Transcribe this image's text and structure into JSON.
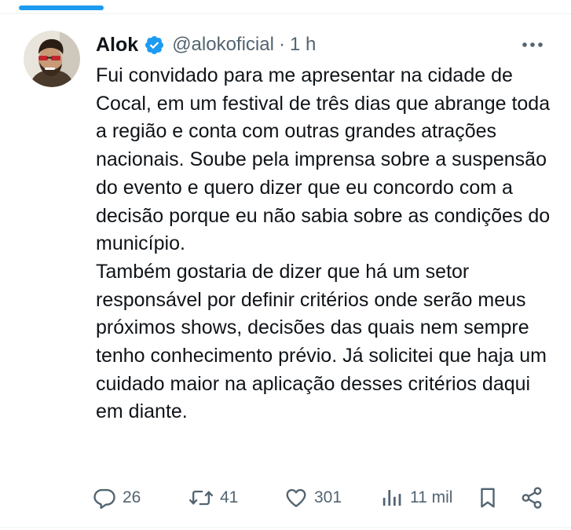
{
  "tweet": {
    "author": {
      "display_name": "Alok",
      "handle": "@alokoficial",
      "verified": true
    },
    "separator": "·",
    "time": "1 h",
    "paragraphs": [
      "Fui convidado para me apresentar na cidade de Cocal, em um festival de três dias que abrange toda a região e conta com outras grandes atrações nacionais. Soube pela imprensa sobre a suspensão do evento e quero dizer que eu concordo com a decisão porque eu não sabia sobre as condições do município.",
      "Também gostaria de dizer que há um setor responsável por definir critérios onde serão meus próximos shows, decisões das quais nem sempre tenho conhecimento prévio. Já solicitei que haja um cuidado maior na aplicação desses critérios daqui em diante."
    ],
    "metrics": {
      "replies": "26",
      "reposts": "41",
      "likes": "301",
      "views": "11 mil"
    },
    "icons": {
      "verified": "verified-badge-icon",
      "more": "more-icon",
      "reply": "reply-icon",
      "repost": "repost-icon",
      "like": "heart-icon",
      "views": "views-icon",
      "bookmark": "bookmark-icon",
      "share": "share-icon"
    }
  },
  "colors": {
    "accent": "#1d9bf0",
    "text": "#0f1419",
    "muted": "#536471",
    "divider": "#eff3f4"
  }
}
